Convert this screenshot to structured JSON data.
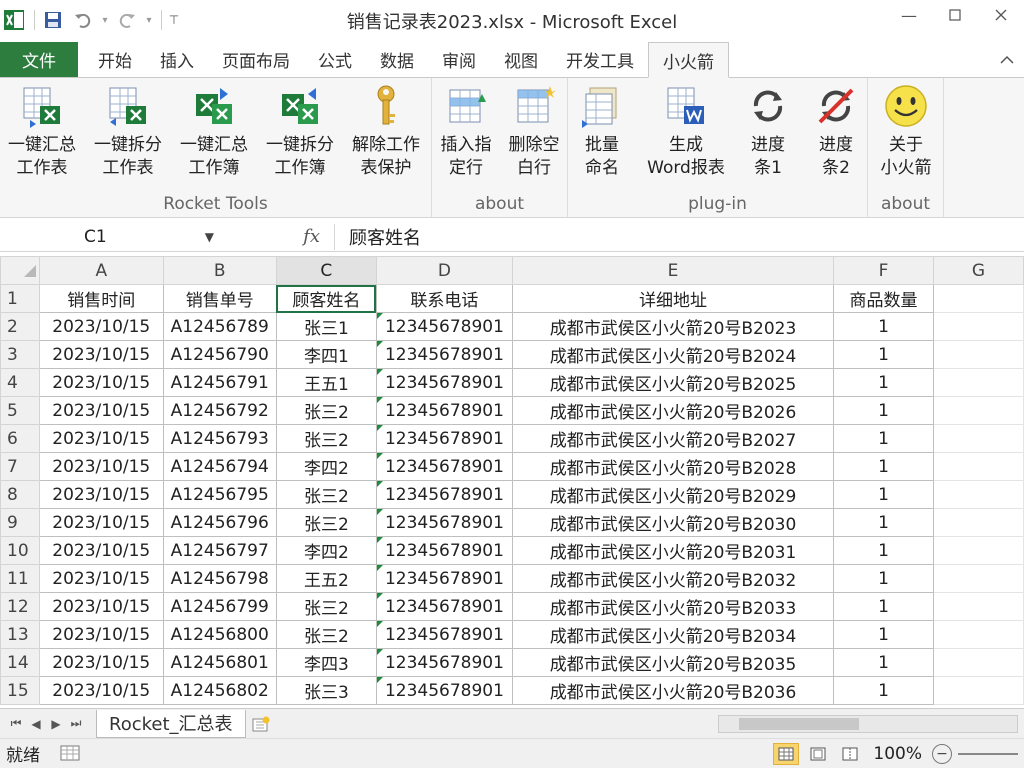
{
  "window": {
    "title": "销售记录表2023.xlsx - Microsoft Excel",
    "minimize": "—",
    "maximize": "",
    "close": ""
  },
  "tabs": [
    {
      "label": "文件"
    },
    {
      "label": "开始"
    },
    {
      "label": "插入"
    },
    {
      "label": "页面布局"
    },
    {
      "label": "公式"
    },
    {
      "label": "数据"
    },
    {
      "label": "审阅"
    },
    {
      "label": "视图"
    },
    {
      "label": "开发工具"
    },
    {
      "label": "小火箭"
    }
  ],
  "ribbon": {
    "groups": [
      {
        "label": "Rocket Tools"
      },
      {
        "label": "about"
      },
      {
        "label": "plug-in"
      },
      {
        "label": "about"
      }
    ],
    "buttons": [
      {
        "label": "一键汇总\n工作表",
        "icon": "merge-sheets-icon"
      },
      {
        "label": "一键拆分\n工作表",
        "icon": "split-sheets-icon"
      },
      {
        "label": "一键汇总\n工作簿",
        "icon": "merge-workbooks-icon"
      },
      {
        "label": "一键拆分\n工作簿",
        "icon": "split-workbooks-icon"
      },
      {
        "label": "解除工作\n表保护",
        "icon": "key-icon"
      },
      {
        "label": "插入指\n定行",
        "icon": "insert-rows-icon"
      },
      {
        "label": "删除空\n白行",
        "icon": "delete-blank-rows-icon"
      },
      {
        "label": "批量\n命名",
        "icon": "batch-rename-icon"
      },
      {
        "label": "生成\nWord报表",
        "icon": "word-report-icon"
      },
      {
        "label": "进度\n条1",
        "icon": "progress-1-icon"
      },
      {
        "label": "进度\n条2",
        "icon": "progress-2-icon"
      },
      {
        "label": "关于\n小火箭",
        "icon": "smiley-icon"
      }
    ]
  },
  "formula_bar": {
    "name_box": "C1",
    "fx": "fx",
    "content": "顾客姓名"
  },
  "grid": {
    "columns": [
      "A",
      "B",
      "C",
      "D",
      "E",
      "F",
      "G"
    ],
    "header_row": [
      "销售时间",
      "销售单号",
      "顾客姓名",
      "联系电话",
      "详细地址",
      "商品数量"
    ],
    "rows": [
      [
        "2023/10/15",
        "A12456789",
        "张三1",
        "12345678901",
        "成都市武侯区小火箭20号B2023",
        "1"
      ],
      [
        "2023/10/15",
        "A12456790",
        "李四1",
        "12345678901",
        "成都市武侯区小火箭20号B2024",
        "1"
      ],
      [
        "2023/10/15",
        "A12456791",
        "王五1",
        "12345678901",
        "成都市武侯区小火箭20号B2025",
        "1"
      ],
      [
        "2023/10/15",
        "A12456792",
        "张三2",
        "12345678901",
        "成都市武侯区小火箭20号B2026",
        "1"
      ],
      [
        "2023/10/15",
        "A12456793",
        "张三2",
        "12345678901",
        "成都市武侯区小火箭20号B2027",
        "1"
      ],
      [
        "2023/10/15",
        "A12456794",
        "李四2",
        "12345678901",
        "成都市武侯区小火箭20号B2028",
        "1"
      ],
      [
        "2023/10/15",
        "A12456795",
        "张三2",
        "12345678901",
        "成都市武侯区小火箭20号B2029",
        "1"
      ],
      [
        "2023/10/15",
        "A12456796",
        "张三2",
        "12345678901",
        "成都市武侯区小火箭20号B2030",
        "1"
      ],
      [
        "2023/10/15",
        "A12456797",
        "李四2",
        "12345678901",
        "成都市武侯区小火箭20号B2031",
        "1"
      ],
      [
        "2023/10/15",
        "A12456798",
        "王五2",
        "12345678901",
        "成都市武侯区小火箭20号B2032",
        "1"
      ],
      [
        "2023/10/15",
        "A12456799",
        "张三2",
        "12345678901",
        "成都市武侯区小火箭20号B2033",
        "1"
      ],
      [
        "2023/10/15",
        "A12456800",
        "张三2",
        "12345678901",
        "成都市武侯区小火箭20号B2034",
        "1"
      ],
      [
        "2023/10/15",
        "A12456801",
        "李四3",
        "12345678901",
        "成都市武侯区小火箭20号B2035",
        "1"
      ],
      [
        "2023/10/15",
        "A12456802",
        "张三3",
        "12345678901",
        "成都市武侯区小火箭20号B2036",
        "1"
      ]
    ],
    "selected_cell": "C1"
  },
  "sheet_tabs": [
    {
      "label": "Rocket_汇总表"
    }
  ],
  "status": {
    "ready": "就绪",
    "zoom": "100%"
  },
  "colors": {
    "file_tab": "#2d7d3e",
    "selection": "#217346"
  }
}
